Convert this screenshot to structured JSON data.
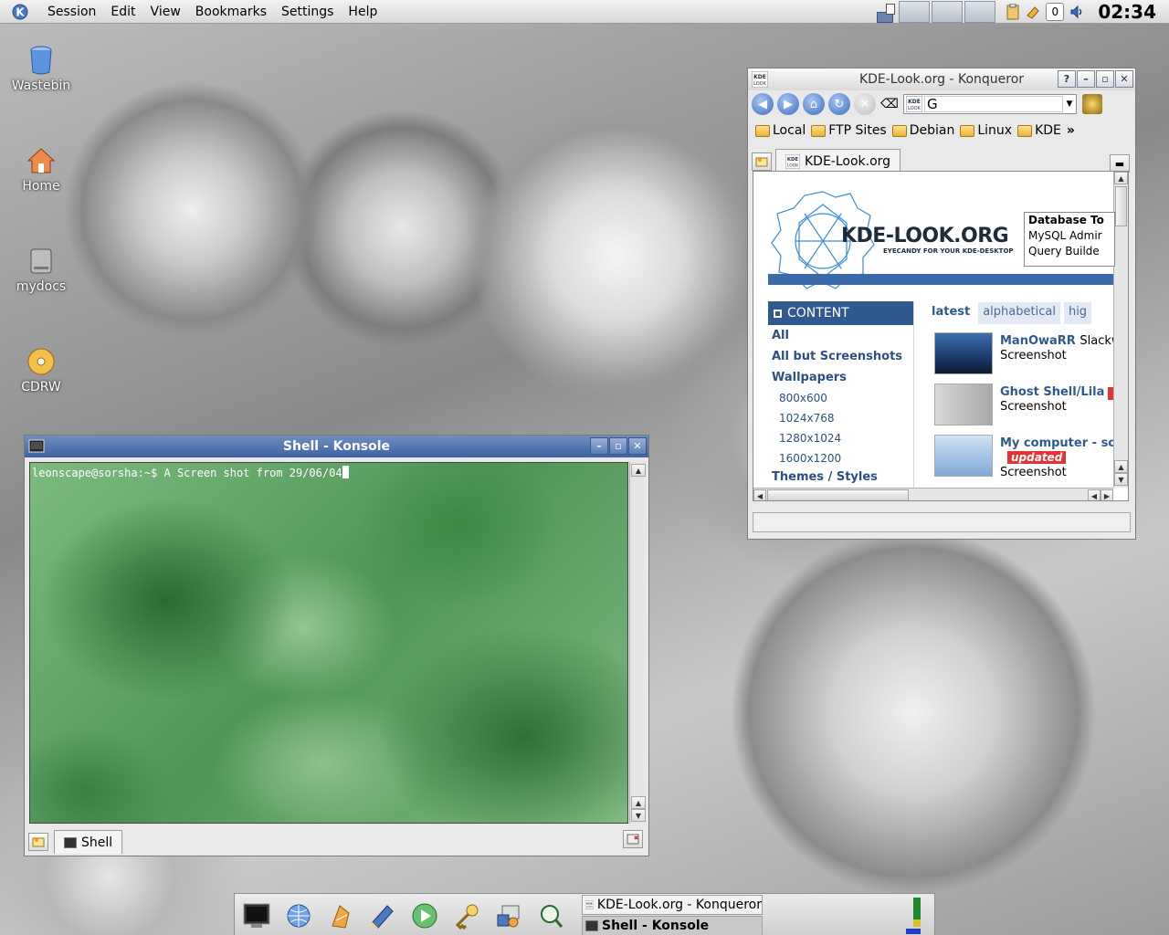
{
  "menubar": {
    "items": [
      "Session",
      "Edit",
      "View",
      "Bookmarks",
      "Settings",
      "Help"
    ],
    "clock": "02:34",
    "tray_counter": "0"
  },
  "desktop_icons": [
    {
      "label": "Wastebin",
      "icon": "trash-icon"
    },
    {
      "label": "Home",
      "icon": "home-icon"
    },
    {
      "label": "mydocs",
      "icon": "drive-icon"
    },
    {
      "label": "CDRW",
      "icon": "cd-icon"
    }
  ],
  "konsole": {
    "title": "Shell - Konsole",
    "prompt": "leonscape@sorsha:~$ A Screen shot from 29/06/04",
    "tab_label": "Shell"
  },
  "konqueror": {
    "title": "KDE-Look.org - Konqueror",
    "url_value": "G",
    "bookmarks": [
      "Local",
      "FTP Sites",
      "Debian",
      "Linux",
      "KDE"
    ],
    "tab_label": "KDE-Look.org",
    "page": {
      "logo": "KDE-LOOK.ORG",
      "logo_sub": "EYECANDY FOR YOUR KDE-DESKTOP",
      "ad_lines": [
        "Database To",
        "MySQL Admir",
        "Query Builde"
      ],
      "content_header": "CONTENT",
      "sidebar": [
        {
          "label": "All",
          "style": "bold"
        },
        {
          "label": "All but Screenshots",
          "style": "bold"
        },
        {
          "label": "Wallpapers",
          "style": "bold"
        },
        {
          "label": "800x600",
          "style": "sub"
        },
        {
          "label": "1024x768",
          "style": "sub"
        },
        {
          "label": "1280x1024",
          "style": "sub"
        },
        {
          "label": "1600x1200",
          "style": "sub"
        },
        {
          "label": "Themes / Styles",
          "style": "bold"
        }
      ],
      "tabs": [
        "latest",
        "alphabetical",
        "hig"
      ],
      "entries": [
        {
          "title": "ManOwaRR",
          "title_extra": "Slackw",
          "category": "Screenshot",
          "badge": ""
        },
        {
          "title": "Ghost Shell/Lila",
          "title_extra": "",
          "category": "Screenshot",
          "badge": ""
        },
        {
          "title": "My computer - scr",
          "title_extra": "",
          "category": "Screenshot",
          "badge": "updated"
        }
      ]
    }
  },
  "taskbar": {
    "tasks": [
      "KDE-Look.org - Konqueror",
      "Shell - Konsole"
    ]
  },
  "colors": {
    "titlebar_active": "#3d62a0",
    "kde_blue": "#30598f",
    "badge_red": "#e53333"
  }
}
